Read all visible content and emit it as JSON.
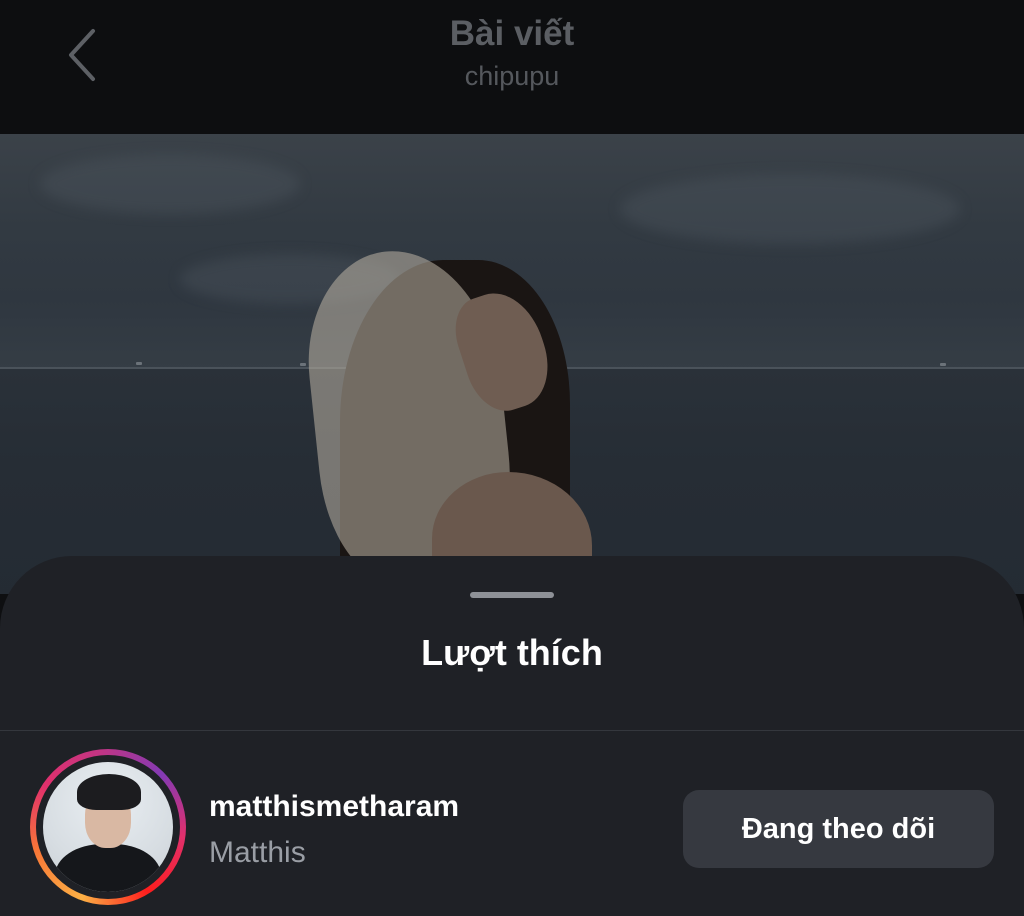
{
  "header": {
    "title": "Bài viết",
    "subtitle": "chipupu",
    "back_icon": "chevron-left-icon"
  },
  "post": {
    "image_description_icon": "post-photo"
  },
  "likes_sheet": {
    "title": "Lượt thích",
    "items": [
      {
        "username": "matthismetharam",
        "full_name": "Matthis",
        "follow_button_label": "Đang theo dõi",
        "has_story_ring": true
      }
    ]
  },
  "colors": {
    "background": "#0d0e10",
    "sheet": "#1f2126",
    "button": "#363940",
    "text_primary": "#ffffff",
    "text_secondary": "#9a9ea5"
  }
}
